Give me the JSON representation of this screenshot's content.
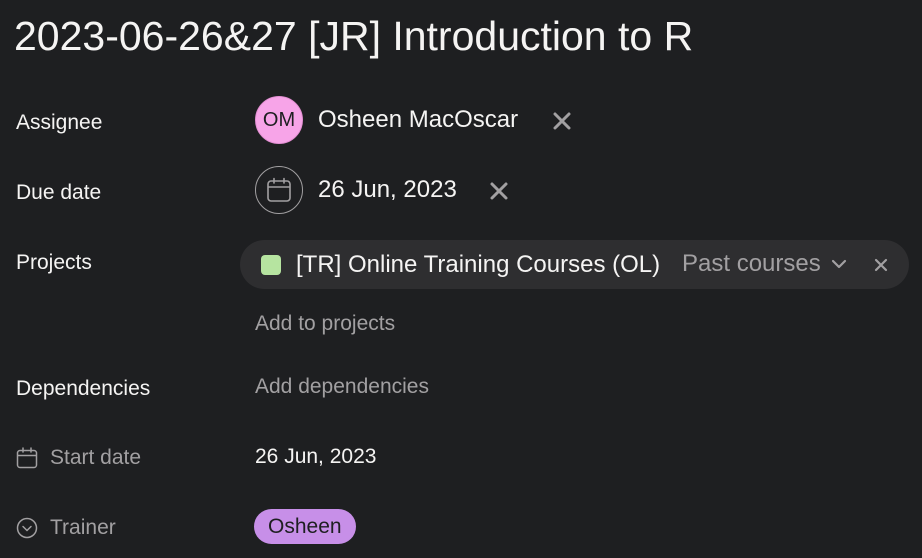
{
  "task": {
    "title": "2023-06-26&27 [JR] Introduction to R"
  },
  "fields": {
    "assignee": {
      "label": "Assignee",
      "initials": "OM",
      "name": "Osheen MacOscar",
      "avatar_color": "#f7a4e8",
      "remove_icon": "close-icon"
    },
    "due_date": {
      "label": "Due date",
      "value": "26 Jun, 2023",
      "icon": "calendar-icon",
      "remove_icon": "close-icon"
    },
    "projects": {
      "label": "Projects",
      "items": [
        {
          "name": "[TR] Online Training Courses (OL)",
          "color": "#b6e4a0",
          "section": "Past courses",
          "section_icon": "chevron-down-icon",
          "remove_icon": "close-icon"
        }
      ],
      "add_label": "Add to projects"
    },
    "dependencies": {
      "label": "Dependencies",
      "add_label": "Add dependencies"
    },
    "start_date": {
      "label": "Start date",
      "icon": "calendar-icon",
      "value": "26 Jun, 2023"
    },
    "trainer": {
      "label": "Trainer",
      "icon": "chevron-circle-icon",
      "value": "Osheen",
      "tag_color": "#c78fe8"
    }
  }
}
